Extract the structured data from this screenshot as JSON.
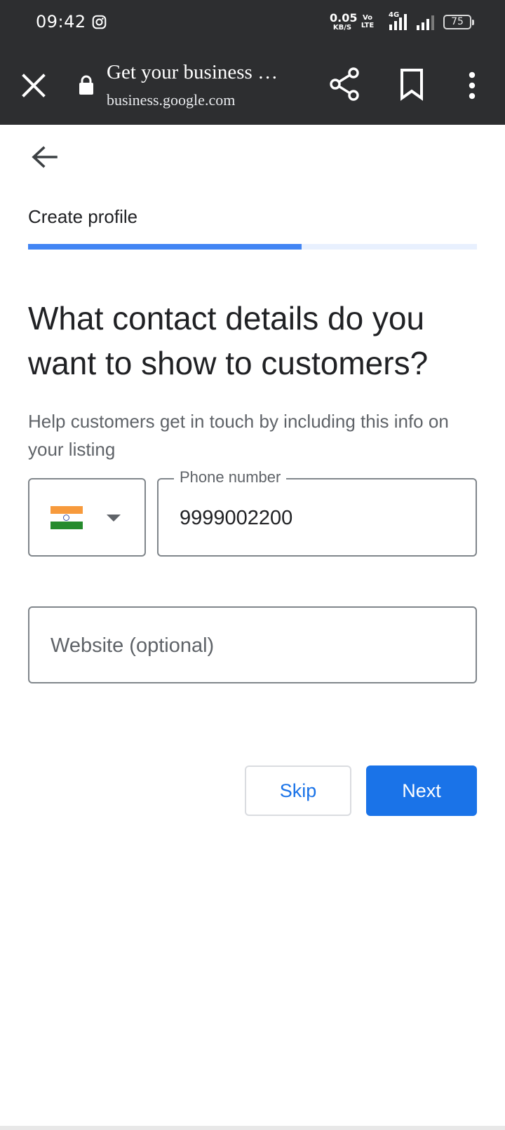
{
  "status_bar": {
    "time": "09:42",
    "notification_icon": "instagram-icon",
    "net_speed_value": "0.05",
    "net_speed_unit": "KB/S",
    "volte_line1": "Vo",
    "volte_line2": "LTE",
    "network_type": "4G",
    "battery": "75"
  },
  "toolbar": {
    "page_title": "Get your business …",
    "url": "business.google.com",
    "close_icon": "close-icon",
    "share_icon": "share-icon",
    "bookmark_icon": "bookmark-icon",
    "menu_icon": "more-vert-icon"
  },
  "step": {
    "title": "Create profile",
    "progress_fraction": 0.61
  },
  "question": "What contact details do you want to show to customers?",
  "helper": "Help customers get in touch by including this info on your listing",
  "phone": {
    "country": "India",
    "label": "Phone number",
    "value": "9999002200"
  },
  "website": {
    "placeholder": "Website (optional)",
    "value": ""
  },
  "actions": {
    "skip": "Skip",
    "next": "Next"
  },
  "colors": {
    "accent": "#1a73e8",
    "progress": "#4285f4",
    "progress_track": "#e8f0fe",
    "toolbar_bg": "#2d2e30"
  }
}
